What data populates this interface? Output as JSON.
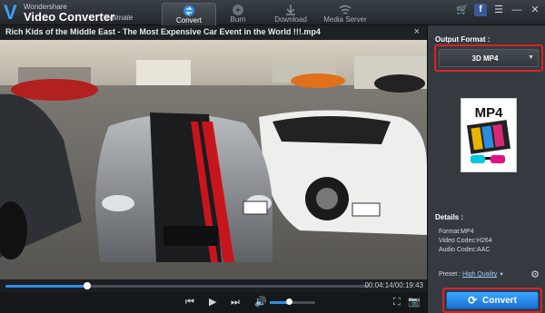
{
  "app": {
    "brand_small": "Wondershare",
    "brand_big": "Video Converter",
    "edition": "Ultimate"
  },
  "tabs": [
    {
      "label": "Convert",
      "active": true,
      "icon": "convert-arrows-icon"
    },
    {
      "label": "Burn",
      "active": false,
      "icon": "disc-icon"
    },
    {
      "label": "Download",
      "active": false,
      "icon": "download-icon"
    },
    {
      "label": "Media Server",
      "active": false,
      "icon": "wifi-icon"
    }
  ],
  "window_controls": {
    "cart": "🛒",
    "facebook": "f",
    "menu": "☰",
    "minimize": "—",
    "close": "✕"
  },
  "video": {
    "title": "Rich Kids of the Middle East - The Most Expensive Car Event in the World !!!.mp4",
    "close": "×",
    "progress": 0.225,
    "time": "00:04:14/00:19:43",
    "volume": 0.42
  },
  "controls": {
    "prev": "⏮",
    "play": "▶",
    "next": "⏭",
    "volume": "🔊",
    "screen": "⛶",
    "camera": "📷"
  },
  "panel": {
    "output_label": "Output Format :",
    "format_value": "3D MP4",
    "format_arrow": "▼",
    "format_card": "MP4",
    "details_label": "Details :",
    "details": [
      "Format:MP4",
      "Video Codec:H264",
      "Audio Codec:AAC"
    ],
    "preset_label": "Preset :",
    "preset_value": "High Quality",
    "preset_arrow": "▼",
    "gear": "⚙",
    "convert_label": "Convert",
    "convert_icon": "⟳"
  },
  "colors": {
    "accent": "#2f8de4",
    "highlight": "#e02020"
  }
}
